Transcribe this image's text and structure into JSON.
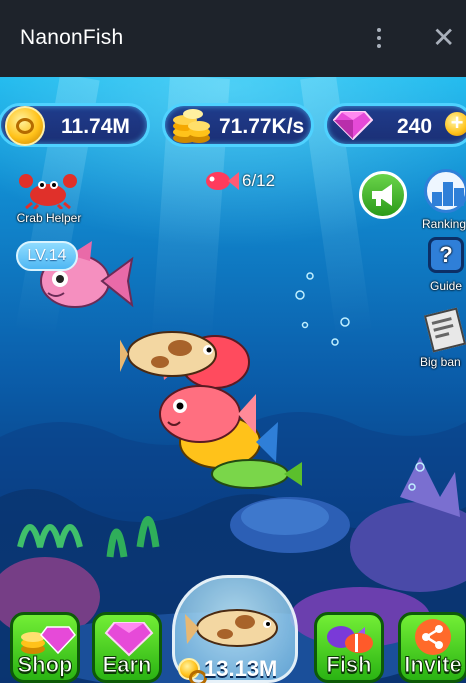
{
  "window": {
    "title": "NanonFish"
  },
  "stats": {
    "coins": "11.74M",
    "income": "71.77K/s",
    "gems": "240"
  },
  "tank": {
    "fish_count": "6/12"
  },
  "left_menu": {
    "crab_helper_label": "Crab Helper"
  },
  "featured_fish": {
    "level": "LV.14"
  },
  "right_menu": {
    "ranking_label": "Ranking",
    "guide_label": "Guide",
    "big_bang_label": "Big ban"
  },
  "bottom_bar": {
    "shop_label": "Shop",
    "earn_label": "Earn",
    "buy_fish_price": "13.13M",
    "fish_label": "Fish",
    "invite_label": "Invite"
  },
  "colors": {
    "titlebar": "#1e232b",
    "ocean_top": "#19b6ec",
    "ocean_bottom": "#0a2c6a",
    "button_green": "#3fca1f",
    "pill_border": "#4fd2ff"
  },
  "icons": [
    "coin-icon",
    "coin-stack-icon",
    "gem-icon",
    "plus-icon",
    "crab-icon",
    "fish-icon",
    "megaphone-icon",
    "podium-icon",
    "question-icon",
    "newspaper-icon",
    "share-icon",
    "more-vert-icon",
    "close-icon"
  ]
}
